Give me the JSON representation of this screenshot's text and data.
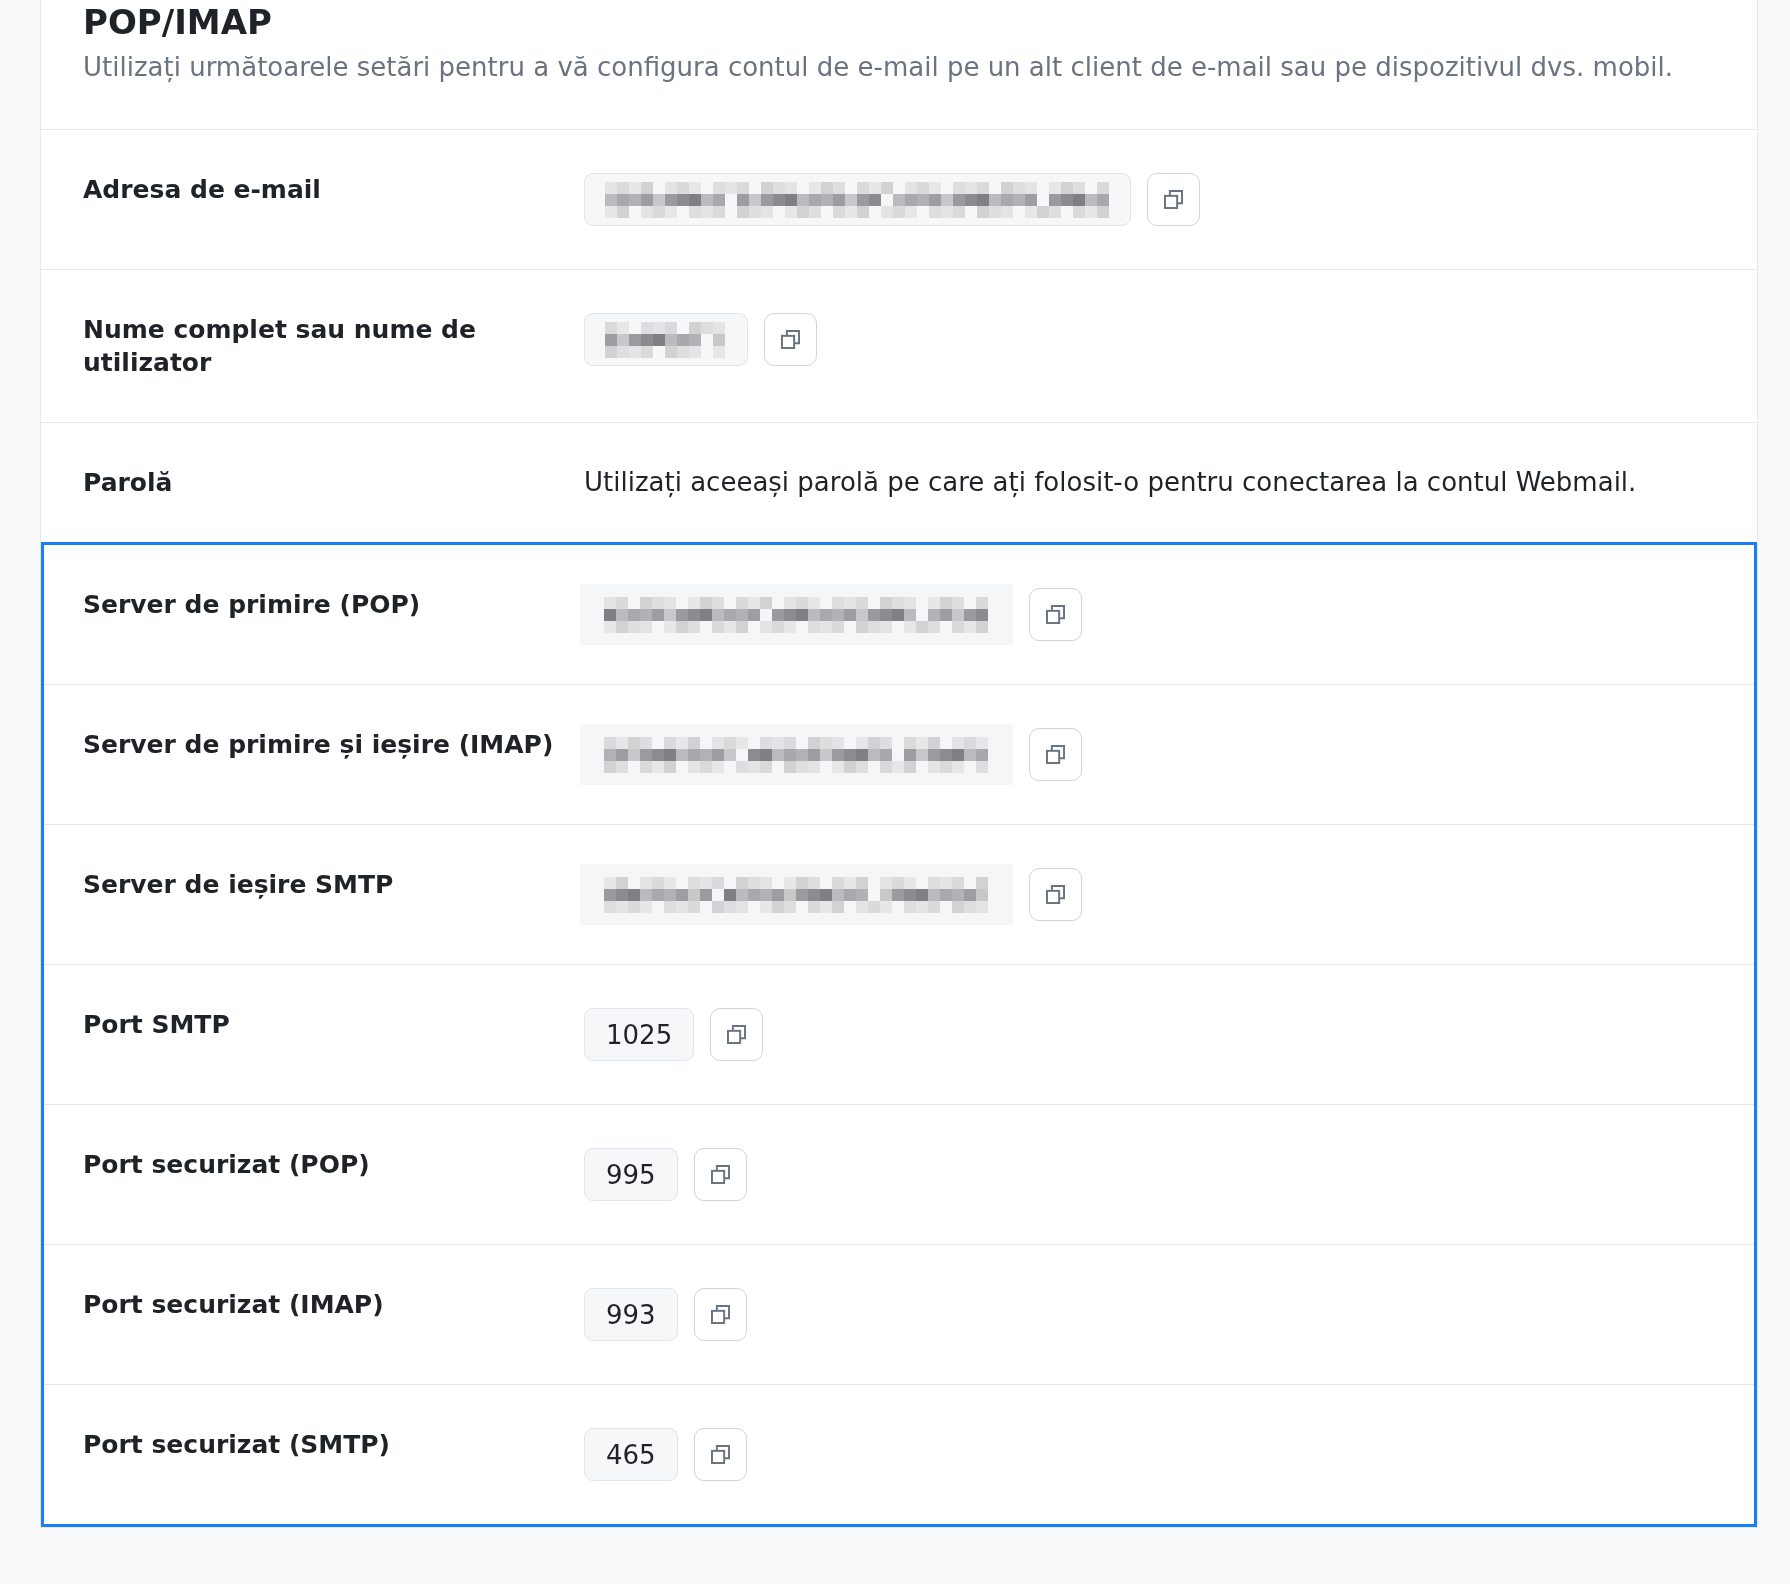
{
  "section": {
    "title": "POP/IMAP",
    "description": "Utilizați următoarele setări pentru a vă configura contul de e-mail pe un alt client de e-mail sau pe dispozitivul dvs. mobil."
  },
  "groups": [
    {
      "highlighted": false,
      "rows": [
        {
          "label": "Adresa de e-mail",
          "kind": "masked_wide"
        },
        {
          "label": "Nume complet sau nume de utilizator",
          "kind": "masked_narrow"
        },
        {
          "label": "Parolă",
          "kind": "note",
          "text": "Utilizați aceeași parolă pe care ați folosit-o pentru conectarea la contul Webmail."
        }
      ]
    },
    {
      "highlighted": true,
      "rows": [
        {
          "label": "Server de primire (POP)",
          "kind": "masked_image"
        },
        {
          "label": "Server de primire și ieșire (IMAP)",
          "kind": "masked_image"
        },
        {
          "label": "Server de ieșire SMTP",
          "kind": "masked_image"
        },
        {
          "label": "Port SMTP",
          "kind": "text",
          "value": "1025"
        },
        {
          "label": "Port securizat (POP)",
          "kind": "text",
          "value": "995"
        },
        {
          "label": "Port securizat (IMAP)",
          "kind": "text",
          "value": "993"
        },
        {
          "label": "Port securizat (SMTP)",
          "kind": "text",
          "value": "465"
        }
      ]
    }
  ]
}
